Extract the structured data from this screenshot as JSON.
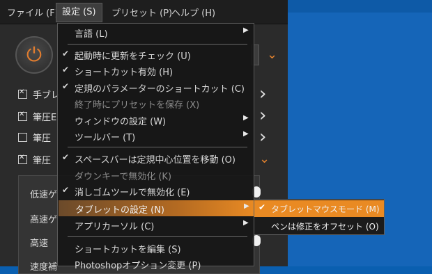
{
  "menubar": {
    "items": [
      "ファイル (F)",
      "設定 (S)",
      "プリセット (P)",
      "ヘルプ (H)"
    ]
  },
  "app": {
    "power_icon": "power-icon",
    "checkboxes": [
      {
        "label": "手ブレ",
        "checked": true
      },
      {
        "label": "筆圧E",
        "checked": true
      },
      {
        "label": "筆圧",
        "checked": false
      },
      {
        "label": "筆圧",
        "checked": true
      }
    ],
    "panel_labels": [
      "低速ゲ",
      "高速ゲ",
      "高速",
      "速度補"
    ]
  },
  "settings_menu": {
    "items": [
      {
        "label": "言語 (L)",
        "checked": false,
        "submenu": true,
        "disabled": false
      },
      {
        "label": "起動時に更新をチェック (U)",
        "checked": true,
        "submenu": false,
        "disabled": false
      },
      {
        "label": "ショートカット有効 (H)",
        "checked": true,
        "submenu": false,
        "disabled": false
      },
      {
        "label": "定規のパラメーターのショートカット (C)",
        "checked": true,
        "submenu": false,
        "disabled": false
      },
      {
        "label": "終了時にプリセットを保存 (X)",
        "checked": false,
        "submenu": false,
        "disabled": true
      },
      {
        "label": "ウィンドウの設定 (W)",
        "checked": false,
        "submenu": true,
        "disabled": false
      },
      {
        "label": "ツールバー (T)",
        "checked": false,
        "submenu": true,
        "disabled": false
      },
      {
        "label": "スペースバーは定規中心位置を移動 (O)",
        "checked": true,
        "submenu": false,
        "disabled": false
      },
      {
        "label": "ダウンキーで無効化 (K)",
        "checked": false,
        "submenu": false,
        "disabled": true
      },
      {
        "label": "消しゴムツールで無効化 (E)",
        "checked": true,
        "submenu": false,
        "disabled": false
      },
      {
        "label": "タブレットの設定 (N)",
        "checked": false,
        "submenu": true,
        "disabled": false,
        "highlighted": true
      },
      {
        "label": "アプリカーソル (C)",
        "checked": false,
        "submenu": true,
        "disabled": false
      },
      {
        "label": "ショートカットを編集 (S)",
        "checked": false,
        "submenu": false,
        "disabled": false
      },
      {
        "label": "Photoshopオプション変更 (P)",
        "checked": false,
        "submenu": false,
        "disabled": false
      }
    ]
  },
  "tablet_submenu": {
    "items": [
      {
        "label": "タブレットマウスモード (M)",
        "checked": true,
        "highlighted": true
      },
      {
        "label": "ペンは修正をオフセット (O)",
        "checked": false,
        "highlighted": false
      }
    ]
  },
  "colors": {
    "accent": "#e98a23",
    "desktop": "#1565b8"
  }
}
